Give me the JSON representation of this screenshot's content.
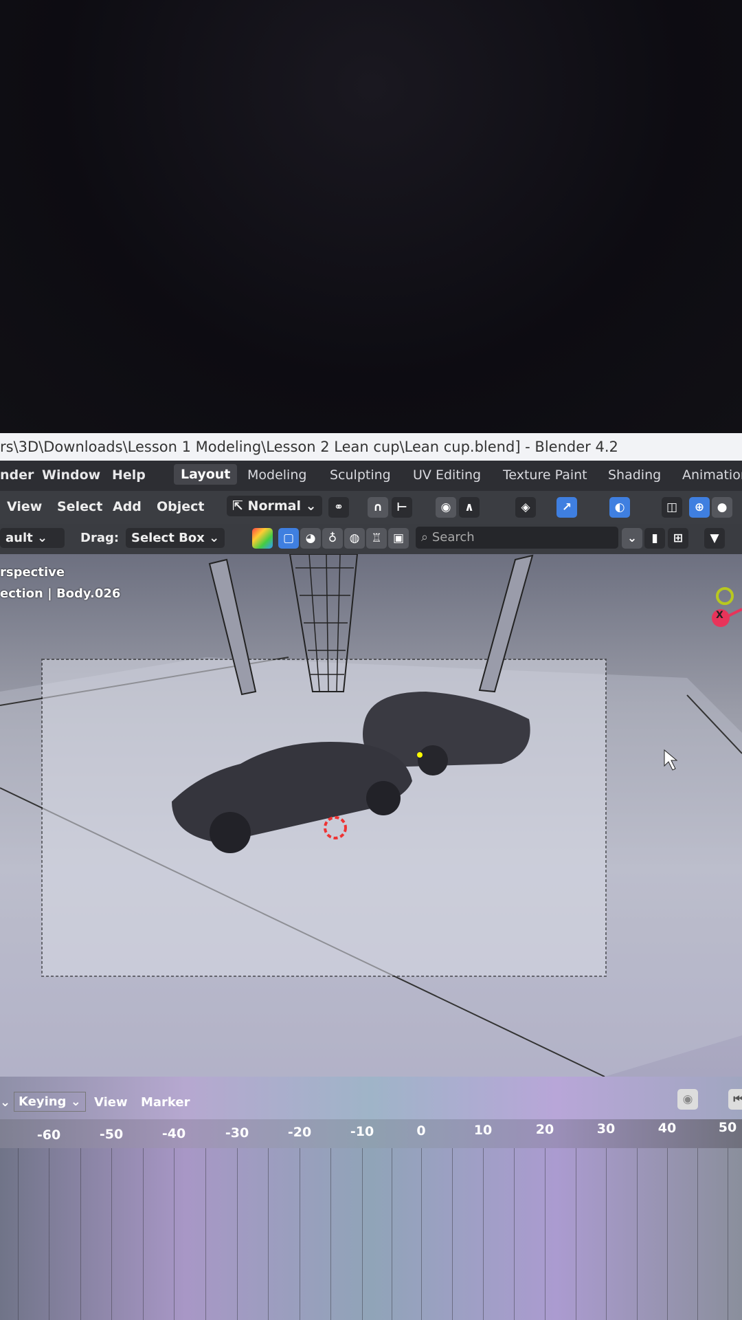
{
  "window": {
    "title": "rs\\3D\\Downloads\\Lesson 1 Modeling\\Lesson 2 Lean cup\\Lean cup.blend] - Blender 4.2"
  },
  "menubar": {
    "menus": [
      "nder",
      "Window",
      "Help"
    ],
    "workspaces": [
      "Layout",
      "Modeling",
      "Sculpting",
      "UV Editing",
      "Texture Paint",
      "Shading",
      "Animation"
    ],
    "active_workspace": "Layout"
  },
  "header": {
    "menus": [
      "View",
      "Select",
      "Add",
      "Object"
    ],
    "transform_orientation": "Normal"
  },
  "tools": {
    "orientation_value": "ault",
    "drag_label": "Drag:",
    "drag_value": "Select Box",
    "search_placeholder": "Search"
  },
  "viewport": {
    "view_name": "rspective",
    "collection_info": "ection | Body.026",
    "gizmo_x_label": "X"
  },
  "timeline": {
    "keying_label": "Keying",
    "menus": [
      "View",
      "Marker"
    ],
    "frames": [
      "-60",
      "-50",
      "-40",
      "-30",
      "-20",
      "-10",
      "0",
      "10",
      "20",
      "30",
      "40",
      "50"
    ]
  },
  "colors": {
    "accent": "#3f7fe0",
    "gizmo_x": "#e8345a",
    "gizmo_y": "#b8c820"
  }
}
